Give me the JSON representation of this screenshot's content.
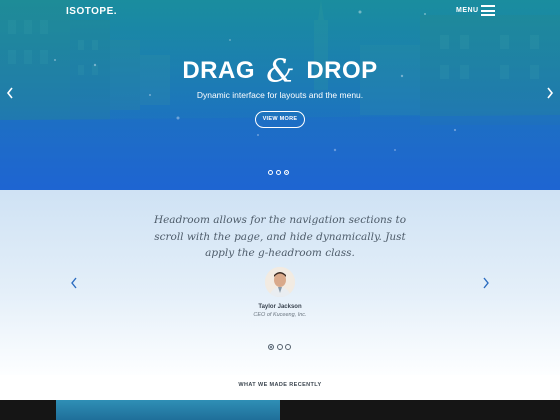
{
  "header": {
    "brand": "ISOTOPE.",
    "menu_label": "MENU"
  },
  "hero": {
    "title_left": "DRAG",
    "title_amp": "&",
    "title_right": "DROP",
    "subtitle": "Dynamic interface for layouts and the menu.",
    "button_label": "VIEW MORE",
    "active_slide": 3,
    "slide_count": 3
  },
  "testimonial": {
    "quote": "Headroom allows for the navigation sections to scroll with the page, and hide dynamically. Just apply the g-headroom class.",
    "name": "Taylor Jackson",
    "role": "CEO of Kuceeng, Inc.",
    "active_slide": 1,
    "slide_count": 3
  },
  "section": {
    "title": "WHAT WE MADE RECENTLY"
  },
  "colors": {
    "hero_top": "#1d8ea3",
    "hero_bottom": "#1f6ad0",
    "testimonial_bg": "#d6e7f6",
    "text_dark": "#3c4650"
  },
  "icons": {
    "menu": "hamburger-icon",
    "prev": "chevron-left-icon",
    "next": "chevron-right-icon"
  }
}
